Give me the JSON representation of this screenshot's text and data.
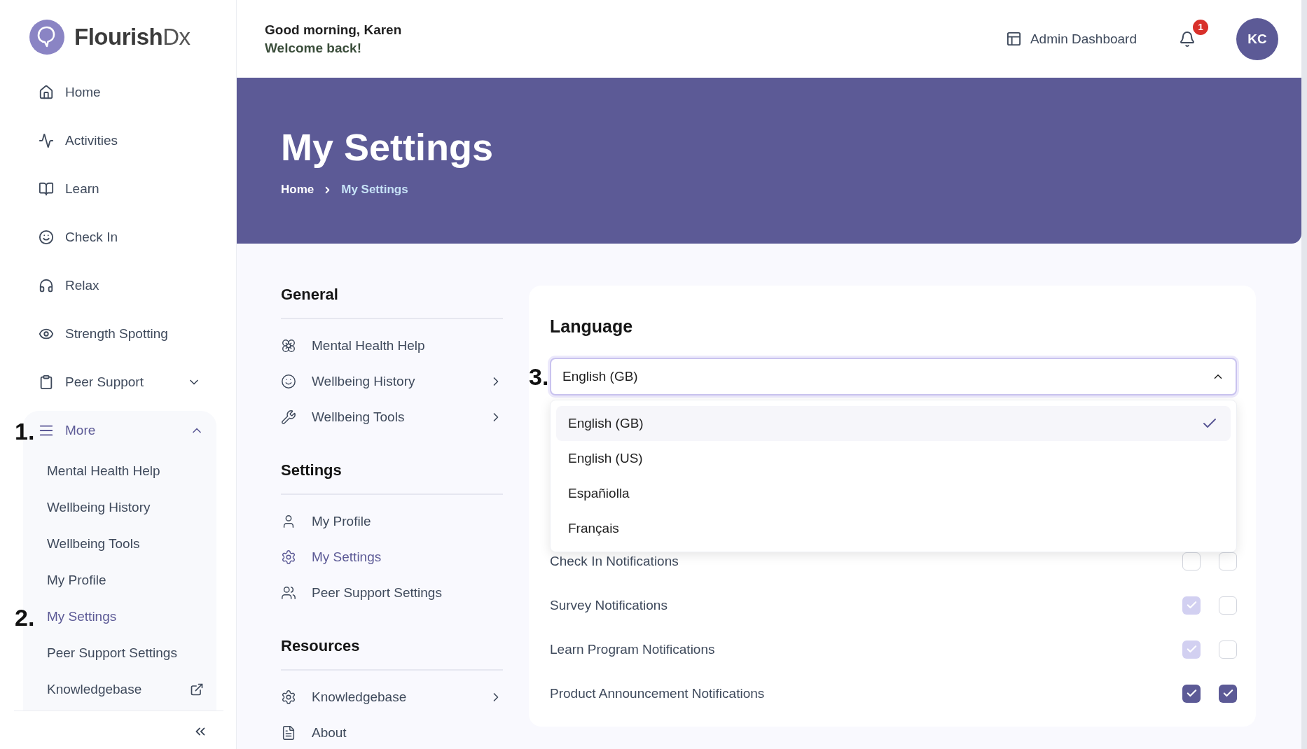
{
  "sidebar": {
    "logo": {
      "name": "Flourish",
      "suffix": "Dx"
    },
    "items": [
      {
        "label": "Home",
        "kind": "link"
      },
      {
        "label": "Activities",
        "kind": "link"
      },
      {
        "label": "Learn",
        "kind": "link"
      },
      {
        "label": "Check In",
        "kind": "link"
      },
      {
        "label": "Relax",
        "kind": "link"
      },
      {
        "label": "Strength Spotting",
        "kind": "link"
      },
      {
        "label": "Peer Support",
        "kind": "group",
        "expanded": false
      },
      {
        "label": "More",
        "kind": "group",
        "expanded": true,
        "marker": "1.",
        "children": [
          {
            "label": "Mental Health Help",
            "selected": false,
            "external": false
          },
          {
            "label": "Wellbeing History",
            "selected": false,
            "external": false
          },
          {
            "label": "Wellbeing Tools",
            "selected": false,
            "external": false
          },
          {
            "label": "My Profile",
            "selected": false,
            "external": false
          },
          {
            "label": "My Settings",
            "selected": true,
            "external": false,
            "marker": "2."
          },
          {
            "label": "Peer Support Settings",
            "selected": false,
            "external": false
          },
          {
            "label": "Knowledgebase",
            "selected": false,
            "external": true
          }
        ]
      }
    ]
  },
  "header": {
    "greeting": "Good morning, Karen",
    "subtitle": "Welcome back!",
    "admin_link": "Admin Dashboard",
    "notification_count": "1",
    "avatar": "KC"
  },
  "banner": {
    "title": "My Settings",
    "breadcrumb": [
      {
        "label": "Home",
        "current": false
      },
      {
        "label": "My Settings",
        "current": true
      }
    ]
  },
  "settings_nav": [
    {
      "title": "General",
      "items": [
        {
          "label": "Mental Health Help",
          "submenu": false,
          "selected": false
        },
        {
          "label": "Wellbeing History",
          "submenu": true,
          "selected": false
        },
        {
          "label": "Wellbeing Tools",
          "submenu": true,
          "selected": false
        }
      ]
    },
    {
      "title": "Settings",
      "items": [
        {
          "label": "My Profile",
          "submenu": false,
          "selected": false
        },
        {
          "label": "My Settings",
          "submenu": false,
          "selected": true
        },
        {
          "label": "Peer Support Settings",
          "submenu": false,
          "selected": false
        }
      ]
    },
    {
      "title": "Resources",
      "items": [
        {
          "label": "Knowledgebase",
          "submenu": true,
          "selected": false
        },
        {
          "label": "About",
          "submenu": false,
          "selected": false
        }
      ]
    }
  ],
  "language": {
    "title": "Language",
    "marker": "3.",
    "value": "English (GB)",
    "expanded": true,
    "options": [
      {
        "label": "English (GB)",
        "selected": true
      },
      {
        "label": "English (US)",
        "selected": false
      },
      {
        "label": "Españiolla",
        "selected": false
      },
      {
        "label": "Français",
        "selected": false
      }
    ]
  },
  "notifications": [
    {
      "label": "Check In Notifications",
      "options": [
        {
          "checked": false,
          "disabled": false
        },
        {
          "checked": false,
          "disabled": false
        }
      ]
    },
    {
      "label": "Survey Notifications",
      "options": [
        {
          "checked": true,
          "disabled": true
        },
        {
          "checked": false,
          "disabled": false
        }
      ]
    },
    {
      "label": "Learn Program Notifications",
      "options": [
        {
          "checked": true,
          "disabled": true
        },
        {
          "checked": false,
          "disabled": false
        }
      ]
    },
    {
      "label": "Product Announcement Notifications",
      "options": [
        {
          "checked": true,
          "disabled": false
        },
        {
          "checked": true,
          "disabled": false
        }
      ]
    }
  ]
}
